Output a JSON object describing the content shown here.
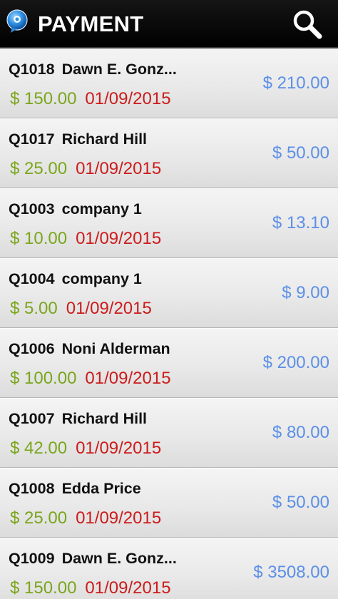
{
  "header": {
    "title": "PAYMENT",
    "logo_icon": "app-logo-icon",
    "search_icon": "search-icon",
    "background": "#000000"
  },
  "colors": {
    "amount_paid": "#7aa61c",
    "date": "#cc1b1b",
    "total": "#5b8fe8",
    "title_text": "#111111"
  },
  "payments": [
    {
      "id": "Q1018",
      "name": "Dawn E. Gonz...",
      "paid": "$ 150.00",
      "date": "01/09/2015",
      "total": "$ 210.00"
    },
    {
      "id": "Q1017",
      "name": "Richard Hill",
      "paid": "$ 25.00",
      "date": "01/09/2015",
      "total": "$ 50.00"
    },
    {
      "id": "Q1003",
      "name": "company 1",
      "paid": "$ 10.00",
      "date": "01/09/2015",
      "total": "$ 13.10"
    },
    {
      "id": "Q1004",
      "name": "company 1",
      "paid": "$ 5.00",
      "date": "01/09/2015",
      "total": "$ 9.00"
    },
    {
      "id": "Q1006",
      "name": "Noni Alderman",
      "paid": "$ 100.00",
      "date": "01/09/2015",
      "total": "$ 200.00"
    },
    {
      "id": "Q1007",
      "name": "Richard Hill",
      "paid": "$ 42.00",
      "date": "01/09/2015",
      "total": "$ 80.00"
    },
    {
      "id": "Q1008",
      "name": "Edda Price",
      "paid": "$ 25.00",
      "date": "01/09/2015",
      "total": "$ 50.00"
    },
    {
      "id": "Q1009",
      "name": "Dawn E. Gonz...",
      "paid": "$ 150.00",
      "date": "01/09/2015",
      "total": "$ 3508.00"
    }
  ]
}
